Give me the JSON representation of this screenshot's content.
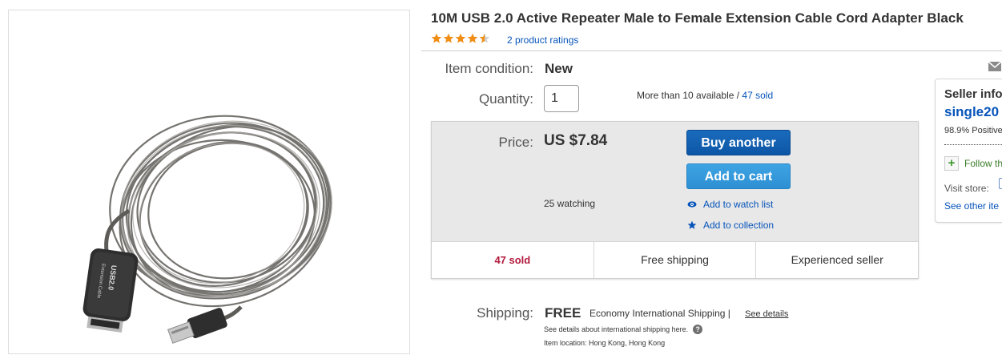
{
  "product": {
    "title": "10M USB 2.0 Active Repeater Male to Female Extension Cable Cord Adapter Black",
    "rating": 4.5,
    "rating_max": 5,
    "ratings_link": "2 product ratings",
    "image_connector_text": [
      "USB2.0",
      "Extension Cable"
    ]
  },
  "details": {
    "condition_label": "Item condition:",
    "condition_value": "New",
    "quantity_label": "Quantity:",
    "quantity_value": "1",
    "availability_text": "More than 10 available / ",
    "sold_link": "47 sold"
  },
  "price": {
    "label": "Price:",
    "value": "US $7.84",
    "buy_button": "Buy another",
    "cart_button": "Add to cart",
    "watching": "25 watching",
    "watch_link": "Add to watch list",
    "collection_link": "Add to collection"
  },
  "signals": [
    "47 sold",
    "Free shipping",
    "Experienced seller"
  ],
  "shipping": {
    "label": "Shipping:",
    "free": "FREE",
    "method": "Economy International Shipping |",
    "details_link": "See details",
    "intl_note": "See details about international shipping here.",
    "help_icon": "?",
    "location": "Item location:  Hong Kong, Hong Kong"
  },
  "seller": {
    "title": "Seller info",
    "name": "single20",
    "feedback": "98.9% Positive",
    "follow": "Follow th",
    "follow_icon": "+",
    "visit_store": "Visit store:",
    "see_other": "See other ite"
  },
  "colors": {
    "link": "#0654ba",
    "buy_button": "#0d56a6",
    "cart_button": "#2d8fd2",
    "star": "#f18d14",
    "sold_red": "#b21a3c",
    "price_box": "#e8e8e8"
  },
  "icons": {
    "watch": "eye-icon",
    "collection": "star-icon",
    "mail": "envelope-icon",
    "follow": "plus-icon",
    "help": "question-icon"
  }
}
